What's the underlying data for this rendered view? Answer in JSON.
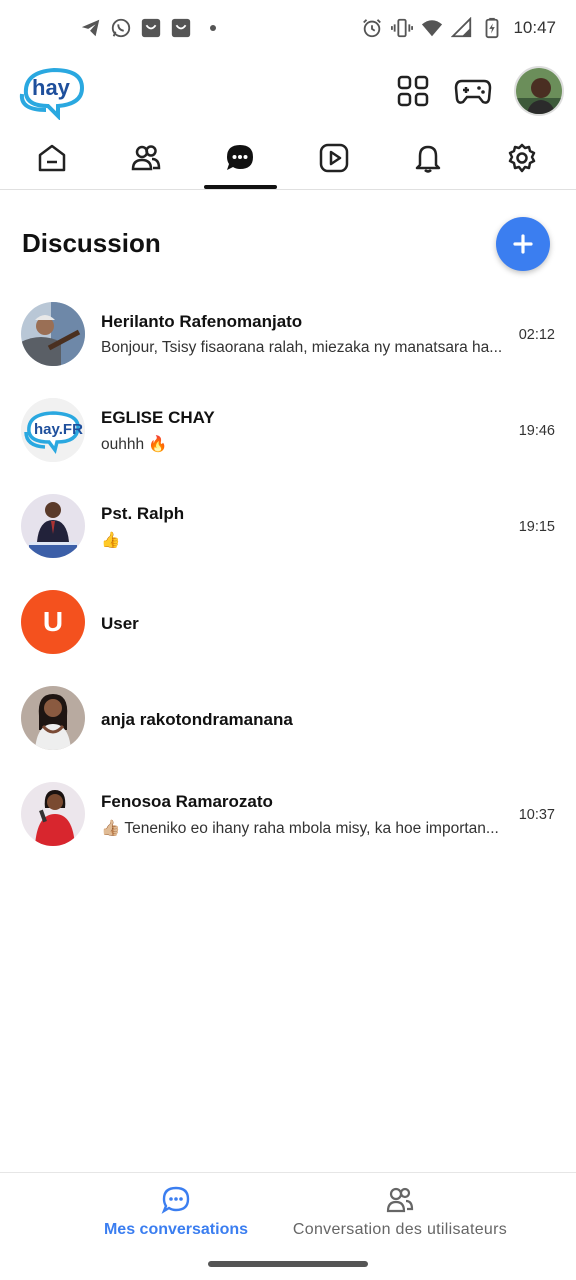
{
  "status_bar": {
    "time": "10:47",
    "left_icons": [
      "telegram-icon",
      "whatsapp-icon",
      "shop-icon",
      "shop-icon"
    ],
    "right_icons": [
      "alarm-icon",
      "vibrate-icon",
      "wifi-icon",
      "signal-icon",
      "battery-charging-icon"
    ]
  },
  "header": {
    "logo_text": "hay",
    "apps_icon": "grid-icon",
    "game_icon": "gamepad-icon"
  },
  "tabs": [
    {
      "icon": "home-icon",
      "active": false
    },
    {
      "icon": "friends-icon",
      "active": false
    },
    {
      "icon": "chat-icon",
      "active": true
    },
    {
      "icon": "video-icon",
      "active": false
    },
    {
      "icon": "bell-icon",
      "active": false
    },
    {
      "icon": "gear-icon",
      "active": false
    }
  ],
  "section": {
    "title": "Discussion",
    "add_icon": "plus-icon"
  },
  "conversations": [
    {
      "name": "Herilanto Rafenomanjato",
      "message": "Bonjour, Tsisy fisaorana ralah, miezaka ny manatsara ha...",
      "time": "02:12"
    },
    {
      "name": "EGLISE CHAY",
      "message": "ouhhh 🔥",
      "time": "19:46",
      "avatar_text": "hay.FR"
    },
    {
      "name": "Pst. Ralph",
      "message": "👍",
      "time": "19:15"
    },
    {
      "name": "User",
      "message": "",
      "time": "",
      "avatar_letter": "U"
    },
    {
      "name": "anja rakotondramanana",
      "message": "",
      "time": ""
    },
    {
      "name": "Fenosoa Ramarozato",
      "message": "👍🏼 Teneniko eo ihany raha mbola misy, ka hoe importan...",
      "time": "10:37"
    }
  ],
  "bottom_nav": {
    "my_conversations": "Mes conversations",
    "user_conversations": "Conversation des utilisateurs"
  },
  "colors": {
    "accent": "#3b7ef0",
    "user_avatar": "#f4511e"
  }
}
